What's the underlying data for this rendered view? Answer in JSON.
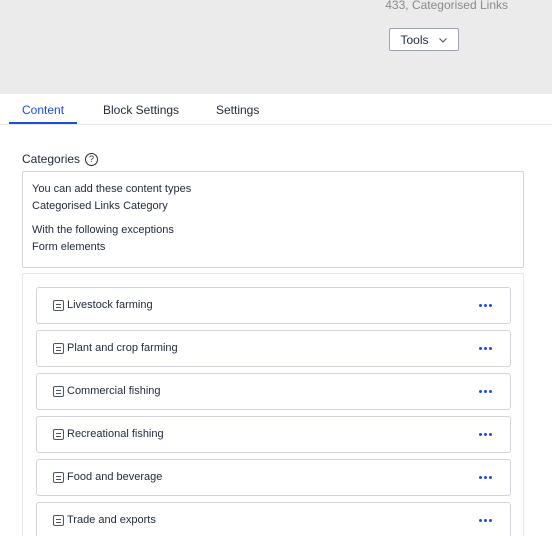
{
  "header": {
    "meta": "433, Categorised Links",
    "tools_label": "Tools"
  },
  "tabs": [
    {
      "label": "Content",
      "active": true
    },
    {
      "label": "Block Settings",
      "active": false
    },
    {
      "label": "Settings",
      "active": false
    }
  ],
  "categories": {
    "label": "Categories",
    "help_icon": "?",
    "info": {
      "allowed_title": "You can add these content types",
      "allowed_value": "Categorised Links Category",
      "exceptions_title": "With the following exceptions",
      "exceptions_value": "Form elements"
    },
    "items": [
      {
        "label": "Livestock farming"
      },
      {
        "label": "Plant and crop farming"
      },
      {
        "label": "Commercial fishing"
      },
      {
        "label": "Recreational fishing"
      },
      {
        "label": "Food and beverage"
      },
      {
        "label": "Trade and exports"
      }
    ]
  },
  "colors": {
    "accent": "#1d4ed8",
    "header_bg": "#ebebeb"
  }
}
